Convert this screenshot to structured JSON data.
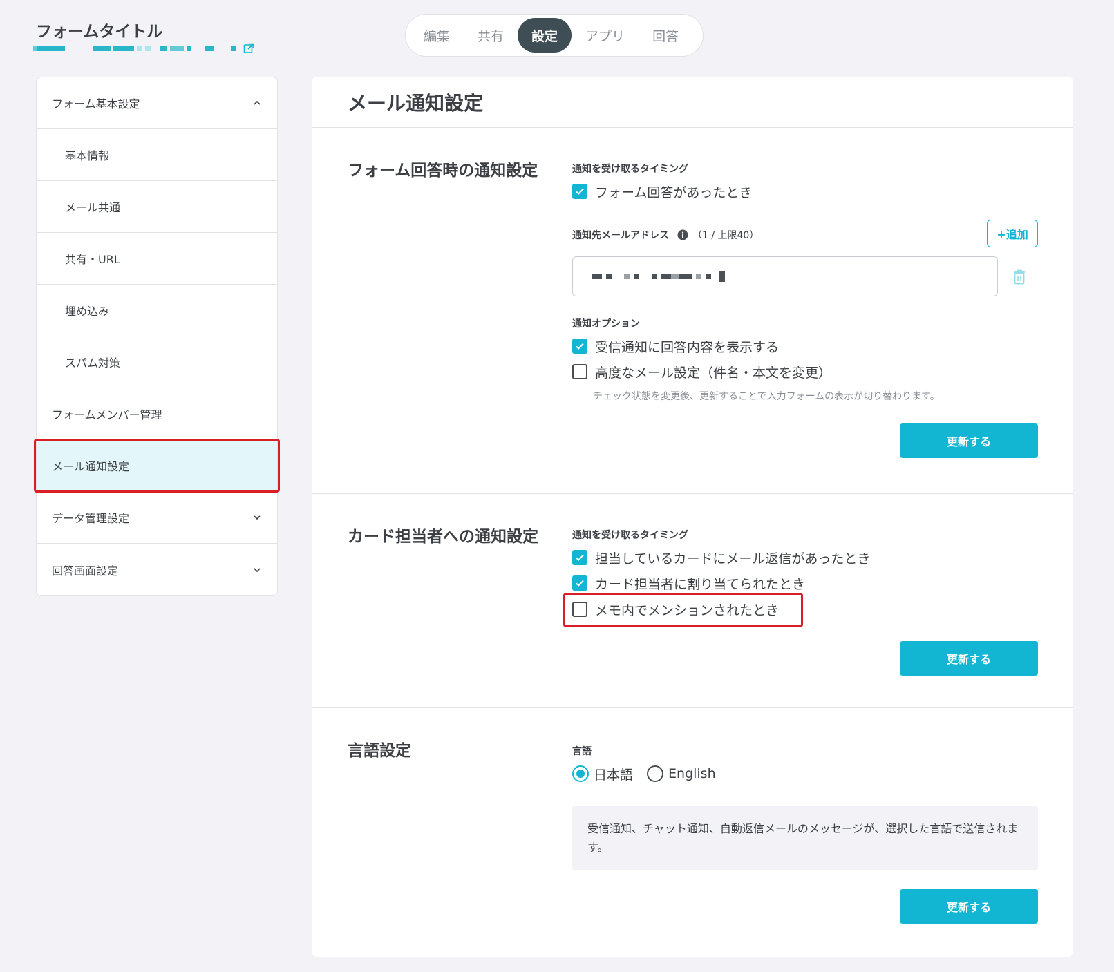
{
  "header": {
    "form_title": "フォームタイトル",
    "external_link_icon": "external-link-icon"
  },
  "tabs": [
    {
      "label": "編集",
      "active": false
    },
    {
      "label": "共有",
      "active": false
    },
    {
      "label": "設定",
      "active": true
    },
    {
      "label": "アプリ",
      "active": false
    },
    {
      "label": "回答",
      "active": false
    }
  ],
  "sidebar": {
    "items": [
      {
        "label": "フォーム基本設定",
        "icon": "chevron-up-icon"
      },
      {
        "label": "基本情報"
      },
      {
        "label": "メール共通"
      },
      {
        "label": "共有・URL"
      },
      {
        "label": "埋め込み"
      },
      {
        "label": "スパム対策"
      },
      {
        "label": "フォームメンバー管理"
      },
      {
        "label": "メール通知設定",
        "active": true
      },
      {
        "label": "データ管理設定",
        "icon": "chevron-down-icon"
      },
      {
        "label": "回答画面設定",
        "icon": "chevron-down-icon"
      }
    ]
  },
  "main": {
    "title": "メール通知設定",
    "form_answer": {
      "title": "フォーム回答時の通知設定",
      "timing_label": "通知を受け取るタイミング",
      "timing_option": {
        "label": "フォーム回答があったとき",
        "checked": true
      },
      "email_label": "通知先メールアドレス",
      "email_count": "（1 / 上限40）",
      "add_button": "+追加",
      "options_label": "通知オプション",
      "options": [
        {
          "label": "受信通知に回答内容を表示する",
          "checked": true
        },
        {
          "label": "高度なメール設定（件名・本文を変更）",
          "checked": false
        }
      ],
      "hint": "チェック状態を変更後、更新することで入力フォームの表示が切り替わります。",
      "update_button": "更新する"
    },
    "card_assignee": {
      "title": "カード担当者への通知設定",
      "timing_label": "通知を受け取るタイミング",
      "options": [
        {
          "label": "担当しているカードにメール返信があったとき",
          "checked": true
        },
        {
          "label": "カード担当者に割り当てられたとき",
          "checked": true
        },
        {
          "label": "メモ内でメンションされたとき",
          "checked": false
        }
      ],
      "update_button": "更新する"
    },
    "language": {
      "title": "言語設定",
      "label": "言語",
      "options": [
        {
          "label": "日本語",
          "selected": true
        },
        {
          "label": "English",
          "selected": false
        }
      ],
      "note": "受信通知、チャット通知、自動返信メールのメッセージが、選択した言語で送信されます。",
      "update_button": "更新する"
    }
  },
  "colors": {
    "accent": "#12b5d2",
    "active_tab": "#3f4d55",
    "highlight": "#d91f26",
    "background": "#f3f3f7"
  }
}
